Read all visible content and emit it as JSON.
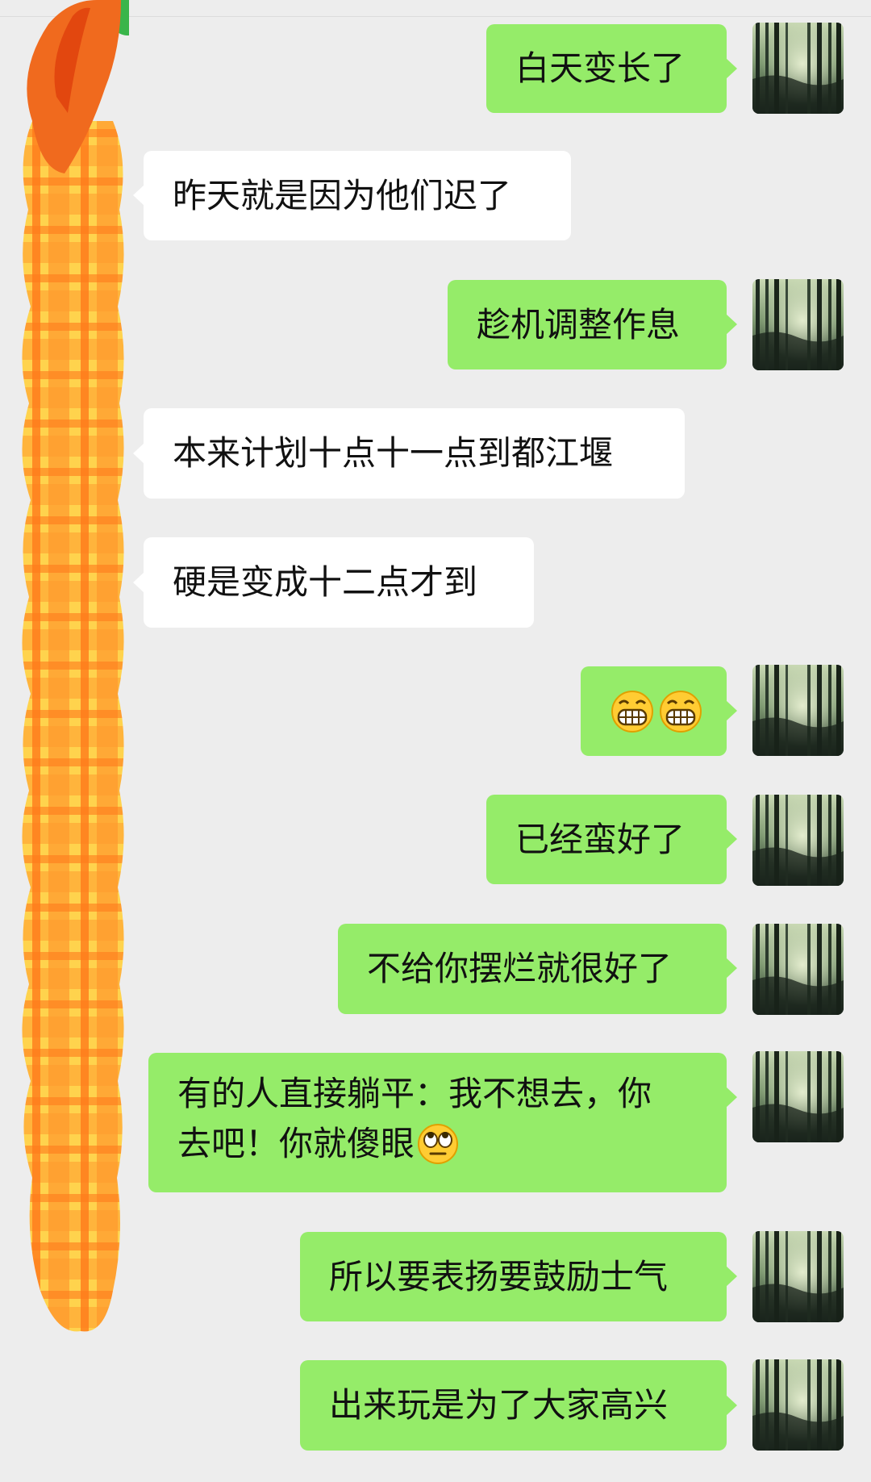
{
  "messages": [
    {
      "side": "out",
      "text": "白天变长了"
    },
    {
      "side": "in",
      "text": "昨天就是因为他们迟了"
    },
    {
      "side": "out",
      "text": "趁机调整作息"
    },
    {
      "side": "in",
      "text": "本来计划十点十一点到都江堰"
    },
    {
      "side": "in",
      "text": "硬是变成十二点才到"
    },
    {
      "side": "out",
      "emoji": [
        "grin-emoji",
        "grin-emoji"
      ]
    },
    {
      "side": "out",
      "text": "已经蛮好了"
    },
    {
      "side": "out",
      "text": "不给你摆烂就很好了"
    },
    {
      "side": "out",
      "text_line1": "有的人直接躺平：我不想去，你",
      "text_line2": "去吧！你就傻眼",
      "emoji": [
        "eye-roll-emoji"
      ]
    },
    {
      "side": "out",
      "text": "所以要表扬要鼓励士气"
    },
    {
      "side": "out",
      "text": "出来玩是为了大家高兴"
    }
  ],
  "icons": {
    "self_avatar": "bamboo-forest-avatar",
    "sender_avatar": "plaid-carrot-sticker-avatar"
  },
  "colors": {
    "background": "#ededed",
    "outgoing_bubble": "#95ec69",
    "incoming_bubble": "#ffffff"
  }
}
